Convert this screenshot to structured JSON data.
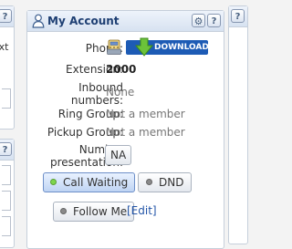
{
  "left_fragment": {
    "help_label": "?",
    "text": "ext"
  },
  "right_fragment": {
    "help_label": "?"
  },
  "my_account": {
    "title": "My Account",
    "help_label": "?",
    "gear_icon": "gear-icon",
    "phone_label": "Phone:",
    "download_label": "DOWNLOAD",
    "extension_label": "Extension:",
    "extension_value": "2000",
    "inbound_label_line1": "Inbound",
    "inbound_label_line2": "numbers:",
    "inbound_value": "None",
    "ring_group_label": "Ring Group:",
    "ring_group_value": "Not a member",
    "pickup_group_label": "Pickup Group:",
    "pickup_group_value": "Not a member",
    "number_presentation_label_line1": "Number",
    "number_presentation_label_line2": "presentation:",
    "number_presentation_button": "NA",
    "call_waiting_label": "Call Waiting",
    "dnd_label": "DND",
    "follow_me_label": "Follow Me",
    "edit_link": "[Edit]"
  },
  "colors": {
    "title_blue": "#1e3f73",
    "green_dot": "#7dd64b",
    "grey_dot": "#8a8a8a",
    "download_blue": "#1d5bb5"
  }
}
